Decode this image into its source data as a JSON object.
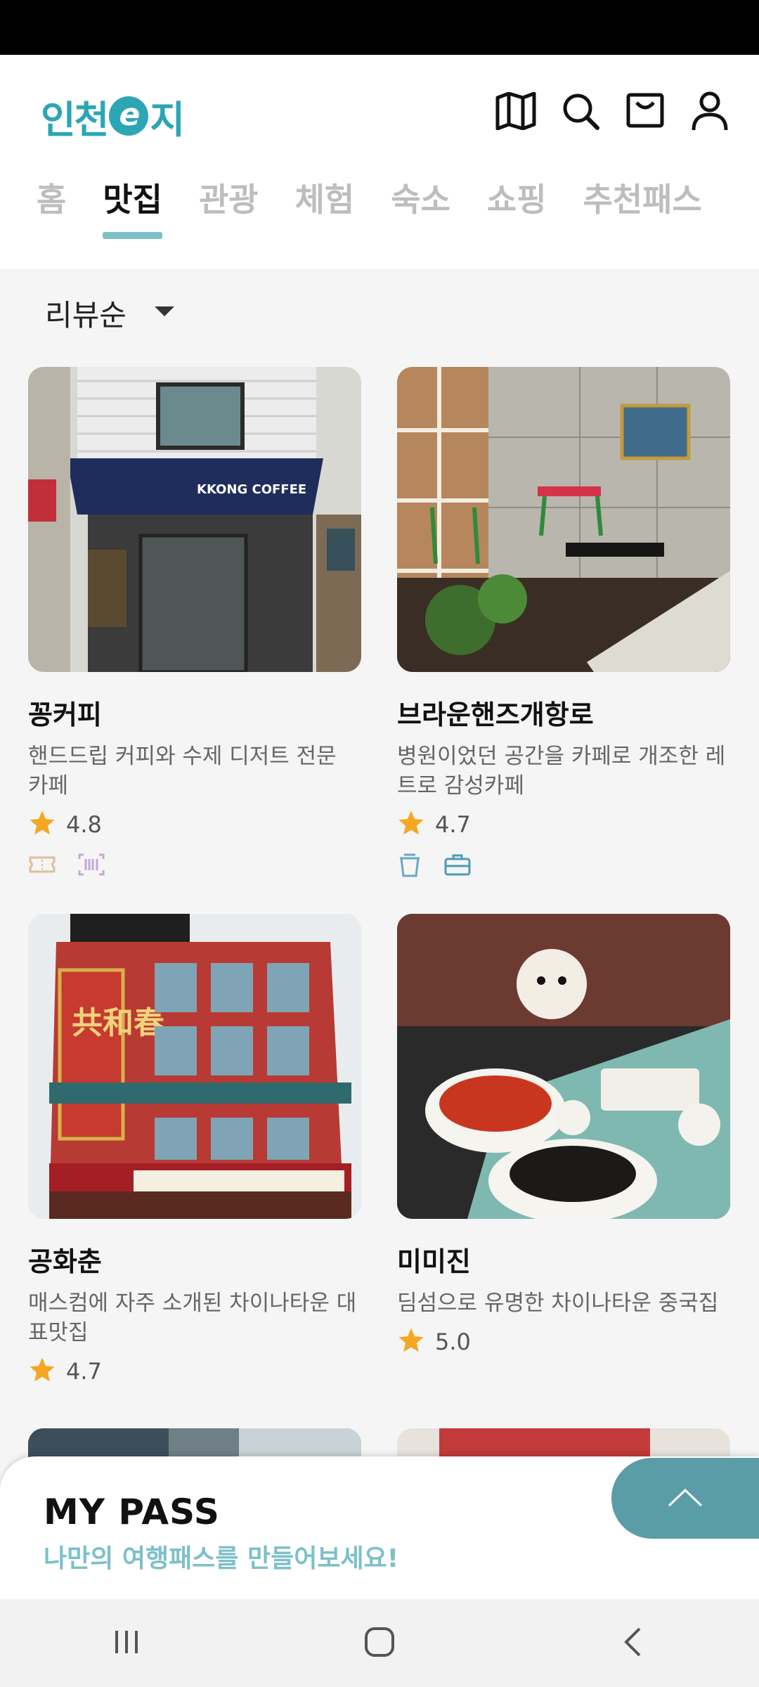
{
  "app": {
    "logo_text_1": "인천",
    "logo_e": "e",
    "logo_text_2": "지"
  },
  "tabs": [
    {
      "label": "홈"
    },
    {
      "label": "맛집"
    },
    {
      "label": "관광"
    },
    {
      "label": "체험"
    },
    {
      "label": "숙소"
    },
    {
      "label": "쇼핑"
    },
    {
      "label": "추천패스"
    }
  ],
  "active_tab": "맛집",
  "sort": {
    "label": "리뷰순"
  },
  "cards": [
    {
      "name": "꽁커피",
      "desc": "핸드드립 커피와 수제 디저트 전문 카페",
      "rating": "4.8",
      "tags": [
        "ticket-icon",
        "barcode-icon"
      ],
      "photo_sign": "KKONG COFFEE"
    },
    {
      "name": "브라운핸즈개항로",
      "desc": "병원이었던 공간을 카페로 개조한 레트로 감성카페",
      "rating": "4.7",
      "tags": [
        "cup-icon",
        "briefcase-icon"
      ]
    },
    {
      "name": "공화춘",
      "desc": "매스컴에 자주 소개된 차이나타운 대표맛집",
      "rating": "4.7",
      "tags": [],
      "photo_sign": "共和春"
    },
    {
      "name": "미미진",
      "desc": "딤섬으로 유명한 차이나타운 중국집",
      "rating": "5.0",
      "tags": []
    }
  ],
  "mypass": {
    "title": "MY PASS",
    "subtitle": "나만의 여행패스를 만들어보세요!"
  },
  "colors": {
    "accent": "#7cc0c9",
    "brand": "#2ca6b5",
    "star": "#f5a623",
    "up_button": "#5a9da6"
  }
}
